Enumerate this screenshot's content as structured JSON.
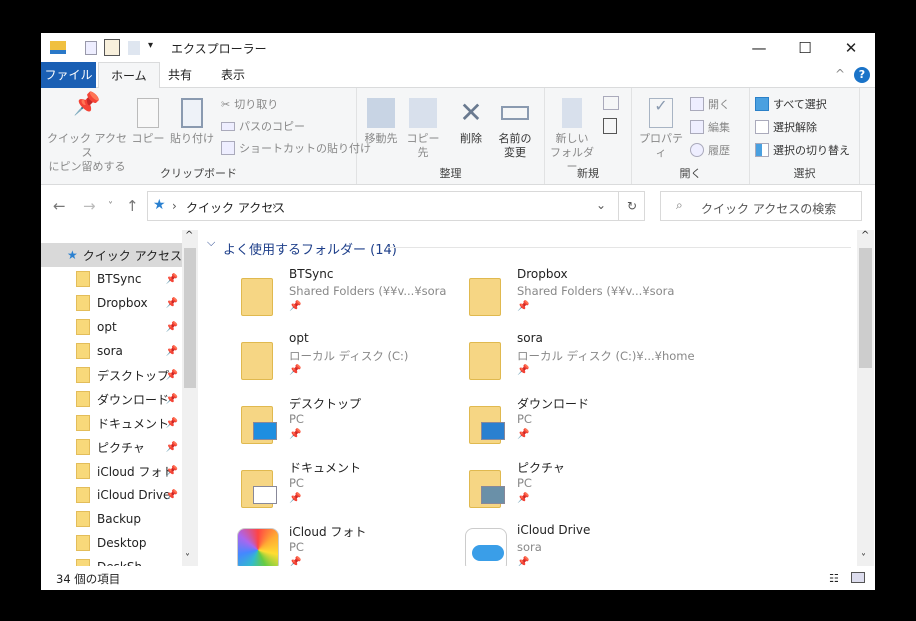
{
  "window": {
    "title": "エクスプローラー"
  },
  "tabs": [
    {
      "label": "ファイル"
    },
    {
      "label": "ホーム"
    },
    {
      "label": "共有"
    },
    {
      "label": "表示"
    }
  ],
  "ribbon": {
    "clipboard": {
      "label": "クリップボード",
      "pin": "クイック アクセス",
      "pin2": "にピン留めする",
      "copy": "コピー",
      "paste": "貼り付け",
      "cut": "切り取り",
      "copy_path": "パスのコピー",
      "paste_shortcut": "ショートカットの貼り付け"
    },
    "organize": {
      "label": "整理",
      "move": "移動先",
      "copy_to": "コピー先",
      "delete": "削除",
      "rename": "名前の",
      "rename2": "変更"
    },
    "new": {
      "label": "新規",
      "new_folder": "新しい",
      "new_folder2": "フォルダー"
    },
    "open": {
      "label": "開く",
      "properties": "プロパティ",
      "open": "開く",
      "edit": "編集",
      "history": "履歴"
    },
    "select": {
      "label": "選択",
      "all": "すべて選択",
      "none": "選択解除",
      "invert": "選択の切り替え"
    }
  },
  "address": {
    "path": "クイック アクセス",
    "search_placeholder": "クイック アクセスの検索"
  },
  "sidebar": {
    "header": "クイック アクセス",
    "items": [
      {
        "label": "BTSync",
        "pinned": true
      },
      {
        "label": "Dropbox",
        "pinned": true
      },
      {
        "label": "opt",
        "pinned": true
      },
      {
        "label": "sora",
        "pinned": true
      },
      {
        "label": "デスクトップ",
        "pinned": true
      },
      {
        "label": "ダウンロード",
        "pinned": true
      },
      {
        "label": "ドキュメント",
        "pinned": true
      },
      {
        "label": "ピクチャ",
        "pinned": true
      },
      {
        "label": "iCloud フォト",
        "pinned": true
      },
      {
        "label": "iCloud Drive",
        "pinned": true
      },
      {
        "label": "Backup",
        "pinned": false
      },
      {
        "label": "Desktop",
        "pinned": false
      },
      {
        "label": "DeskSh",
        "pinned": false
      }
    ]
  },
  "main": {
    "section": "よく使用するフォルダー (14)",
    "folders": [
      {
        "name": "BTSync",
        "location": "Shared Folders (¥¥v...¥sora",
        "icon": "network-folder"
      },
      {
        "name": "Dropbox",
        "location": "Shared Folders (¥¥v...¥sora",
        "icon": "network-folder"
      },
      {
        "name": "opt",
        "location": "ローカル ディスク (C:)",
        "icon": "network-folder"
      },
      {
        "name": "sora",
        "location": "ローカル ディスク (C:)¥...¥home",
        "icon": "network-folder"
      },
      {
        "name": "デスクトップ",
        "location": "PC",
        "icon": "desktop-folder"
      },
      {
        "name": "ダウンロード",
        "location": "PC",
        "icon": "download-folder"
      },
      {
        "name": "ドキュメント",
        "location": "PC",
        "icon": "documents-folder"
      },
      {
        "name": "ピクチャ",
        "location": "PC",
        "icon": "pictures-folder"
      },
      {
        "name": "iCloud フォト",
        "location": "PC",
        "icon": "icloud-photos"
      },
      {
        "name": "iCloud Drive",
        "location": "sora",
        "icon": "icloud-drive"
      }
    ]
  },
  "status": {
    "count": "34 個の項目"
  },
  "colors": {
    "accent": "#1a5fb4",
    "folder": "#f6d684"
  }
}
